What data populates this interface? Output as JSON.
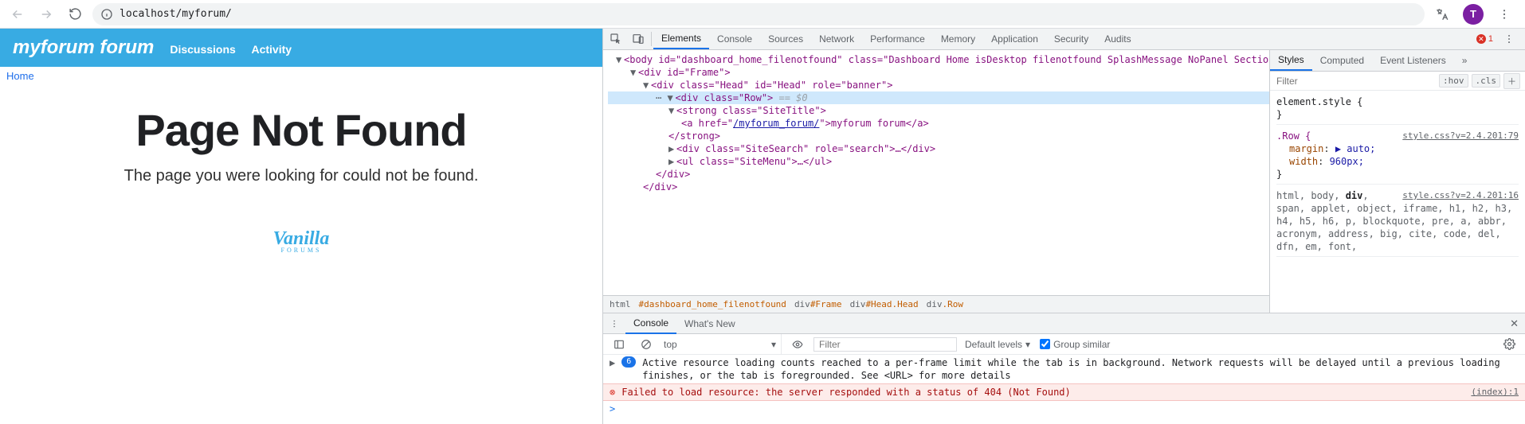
{
  "browser": {
    "url_display": "localhost/myforum/",
    "avatar_letter": "T"
  },
  "forum": {
    "site_title": "myforum forum",
    "nav": {
      "discussions": "Discussions",
      "activity": "Activity"
    },
    "crumb_home": "Home",
    "nf_heading": "Page Not Found",
    "nf_text": "The page you were looking for could not be found.",
    "logo_script": "Vanilla",
    "logo_sub": "FORUMS"
  },
  "devtools": {
    "tabs": {
      "elements": "Elements",
      "console": "Console",
      "sources": "Sources",
      "network": "Network",
      "performance": "Performance",
      "memory": "Memory",
      "application": "Application",
      "security": "Security",
      "audits": "Audits"
    },
    "error_count": "1",
    "dom": {
      "body_open": "<body id=\"dashboard_home_filenotfound\" class=\"Dashboard Home isDesktop filenotfound SplashMessage NoPanel Section-Error\" style>",
      "frame_open": "<div id=\"Frame\">",
      "head_open": "<div class=\"Head\" id=\"Head\" role=\"banner\">",
      "row_open": "<div class=\"Row\">",
      "row_annot": " == $0",
      "strong_open": "<strong class=\"SiteTitle\">",
      "a_open": "<a href=\"",
      "a_href": "/myforum_forum/",
      "a_after": "\">myforum forum</a>",
      "strong_close": "</strong>",
      "search_row": "<div class=\"SiteSearch\" role=\"search\">…</div>",
      "menu_row": "<ul class=\"SiteMenu\">…</ul>",
      "div_close": "</div>"
    },
    "breadcrumb": {
      "p0": "html",
      "p1": "#dashboard_home_filenotfound",
      "p2a": "div",
      "p2b": "#Frame",
      "p3a": "div",
      "p3b": "#Head.Head",
      "p4a": "div",
      "p4b": ".Row"
    },
    "styles": {
      "tabs": {
        "styles": "Styles",
        "computed": "Computed",
        "listeners": "Event Listeners"
      },
      "filter_placeholder": "Filter",
      "hov": ":hov",
      "cls": ".cls",
      "elem_style": "element.style {",
      "brace_close": "}",
      "rule_src_1": "style.css?v=2.4.201:79",
      "rule_sel_1": ".Row {",
      "rule1_p1n": "margin",
      "rule1_p1v": "▶ auto;",
      "rule1_p2n": "width",
      "rule1_p2v": "960px;",
      "rule_src_2": "style.css?v=2.4.201:16",
      "inherited_sel": "html, body, div, span, applet, object, iframe, h1, h2, h3, h4, h5, h6, p, blockquote, pre, a, abbr, acronym, address, big, cite, code, del, dfn, em, font,"
    },
    "drawer": {
      "tabs": {
        "console": "Console",
        "whatsnew": "What's New"
      },
      "ctx": "top",
      "filter_placeholder": "Filter",
      "levels": "Default levels",
      "group": "Group similar",
      "info_badge": "6",
      "info_msg": "Active resource loading counts reached to a per-frame limit while the tab is in background. Network requests will be delayed until a previous loading finishes, or the tab is foregrounded. See <URL> for more details",
      "err_msg": "Failed to load resource: the server responded with a status of 404 (Not Found)",
      "err_src": "(index):1",
      "prompt": ">"
    }
  }
}
